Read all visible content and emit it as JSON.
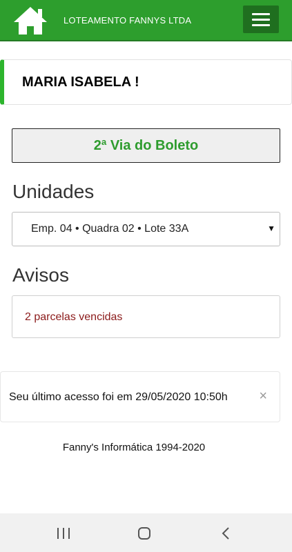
{
  "header": {
    "brand": "LOTEAMENTO FANNYS LTDA",
    "home_icon": "home-icon",
    "menu_icon": "hamburger-menu-icon",
    "color": "#2d9e2d"
  },
  "user": {
    "name": "MARIA ISABELA !"
  },
  "boleto_button": {
    "label": "2ª Via do Boleto"
  },
  "unidades": {
    "title": "Unidades",
    "selected": "Emp. 04 • Quadra 02 • Lote 33A",
    "caret": "▼"
  },
  "avisos": {
    "title": "Avisos",
    "items": [
      "2 parcelas vencidas"
    ]
  },
  "last_access": {
    "text": "Seu último acesso foi em 29/05/2020 10:50h",
    "close": "×"
  },
  "footer": {
    "text": "Fanny's Informática 1994-2020"
  },
  "system_nav": {
    "recents_icon": "recents-icon",
    "home_icon": "android-home-icon",
    "back_icon": "back-icon"
  }
}
